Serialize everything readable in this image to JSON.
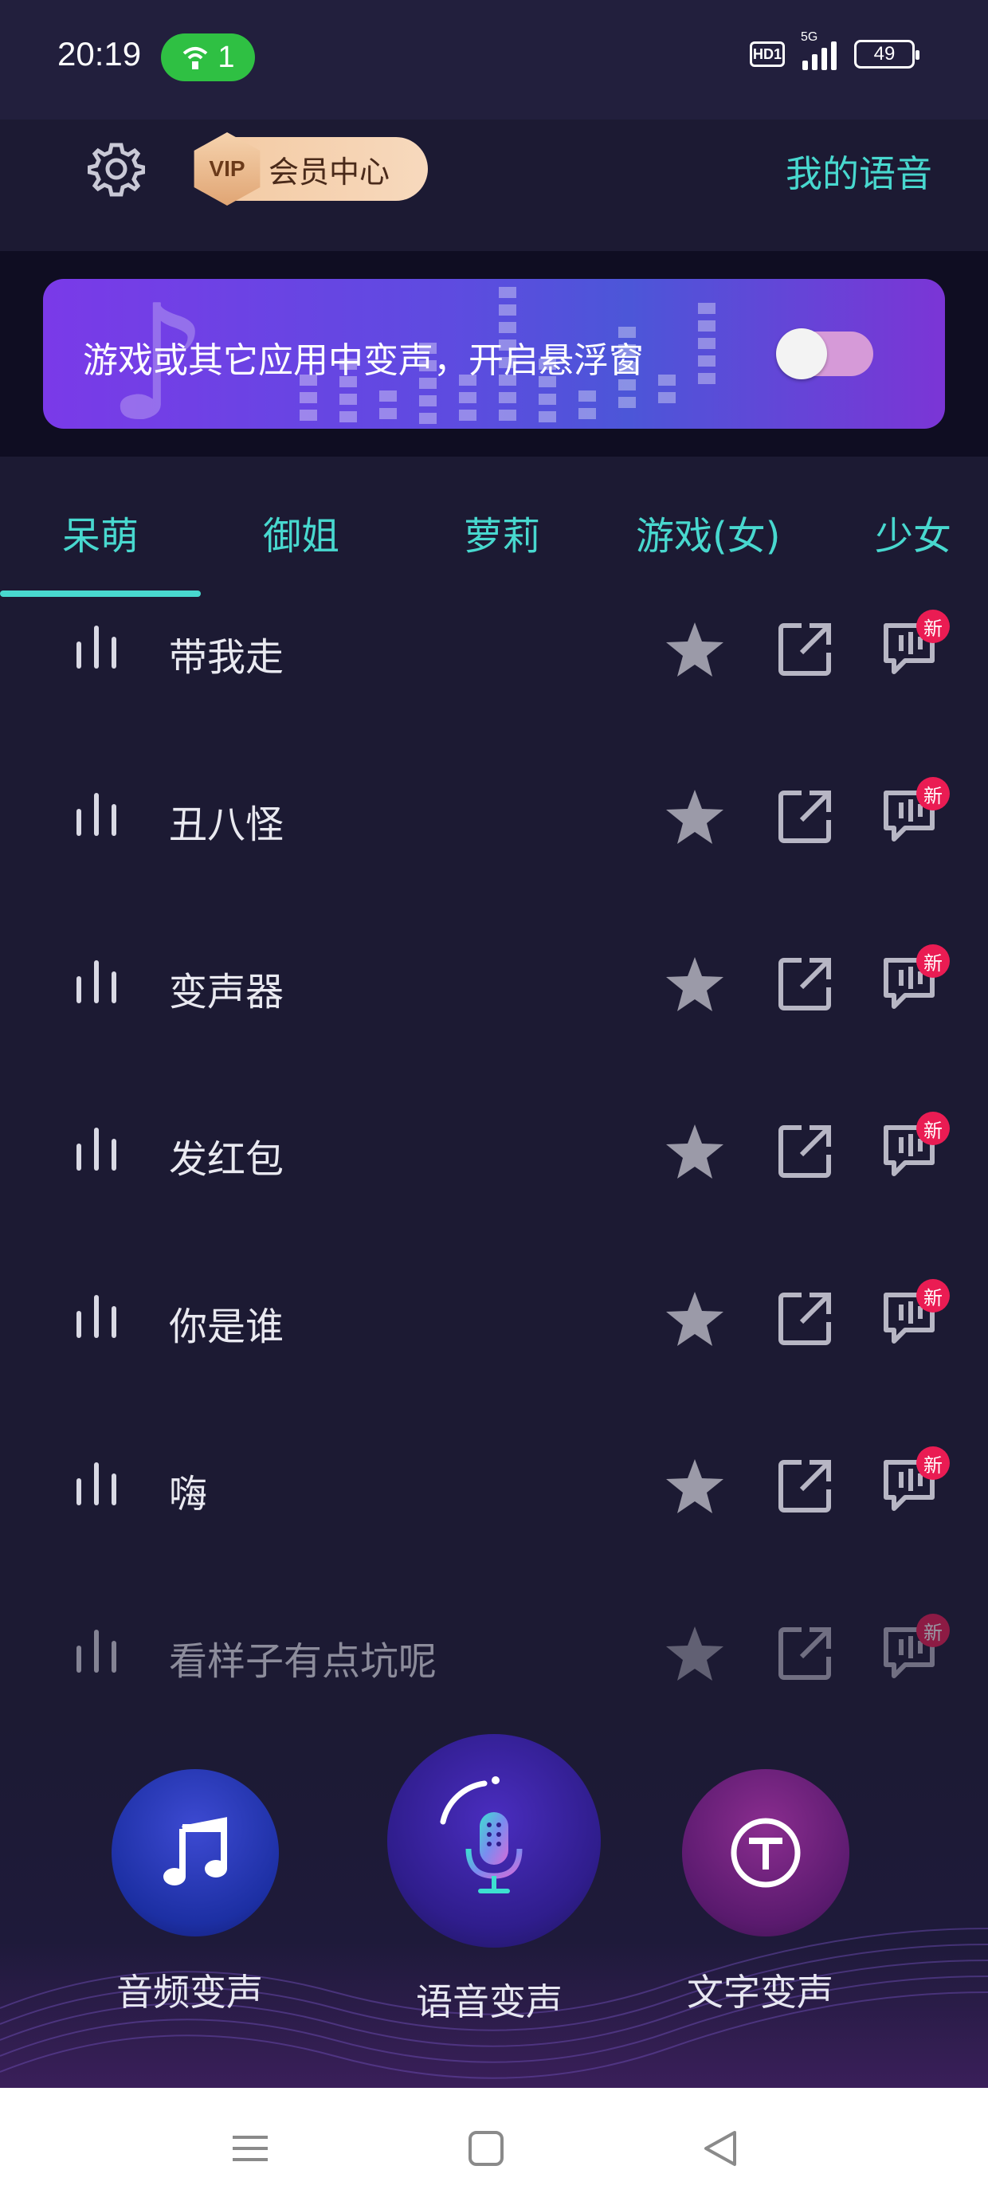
{
  "status_bar": {
    "time": "20:19",
    "hotspot_count": "1",
    "hd_label": "HD1",
    "network_label": "5G",
    "battery": "49"
  },
  "header": {
    "vip_label": "VIP",
    "vip_center": "会员中心",
    "my_voice": "我的语音"
  },
  "banner": {
    "text": "游戏或其它应用中变声，开启悬浮窗",
    "toggle_on": false
  },
  "tabs": [
    {
      "label": "呆萌",
      "active": true
    },
    {
      "label": "御姐",
      "active": false
    },
    {
      "label": "萝莉",
      "active": false
    },
    {
      "label": "游戏(女)",
      "active": false
    },
    {
      "label": "少女",
      "active": false
    }
  ],
  "list_items": [
    {
      "label": "带我走",
      "badge": "新"
    },
    {
      "label": "丑八怪",
      "badge": "新"
    },
    {
      "label": "变声器",
      "badge": "新"
    },
    {
      "label": "发红包",
      "badge": "新"
    },
    {
      "label": "你是谁",
      "badge": "新"
    },
    {
      "label": "嗨",
      "badge": "新"
    },
    {
      "label": "看样子有点坑呢",
      "badge": "新"
    }
  ],
  "bottom_actions": {
    "audio": "音频变声",
    "voice": "语音变声",
    "text": "文字变声"
  },
  "colors": {
    "accent": "#48d8cf",
    "background": "#1c1a33",
    "badge": "#ea1c53"
  }
}
